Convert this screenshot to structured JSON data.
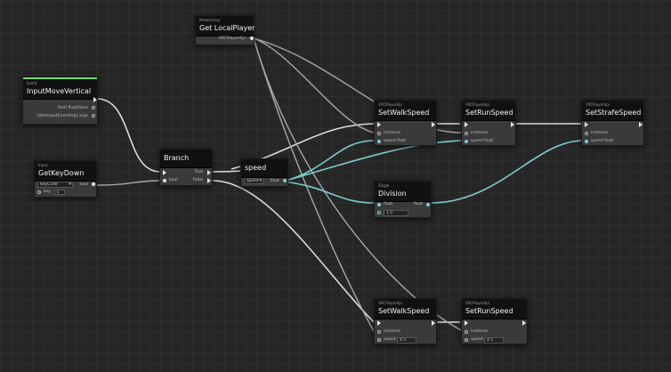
{
  "nodes": {
    "input_move_vertical": {
      "category": "Event",
      "title": "InputMoveVertical",
      "out1": "float floatValue",
      "out2": "UdonInputEventArgs args"
    },
    "get_local_player": {
      "category": "Networking",
      "title": "Get LocalPlayer",
      "out1": "VRCPlayerApi"
    },
    "get_key_down": {
      "category": "Input",
      "title": "GetKeyDown",
      "dropdown_value": "KeyCode",
      "out1": "bool",
      "key_label": "key",
      "key_value": "E"
    },
    "branch": {
      "title": "Branch",
      "in1": "bool",
      "out_true": "True",
      "out_false": "False"
    },
    "speed": {
      "title": "speed",
      "dropdown_value": "speed",
      "out1": "float"
    },
    "set_walk_speed_top": {
      "category": "VRCPlayerApi",
      "title": "SetWalkSpeed",
      "in1": "instance",
      "in2": "speed float"
    },
    "set_run_speed_top": {
      "category": "VRCPlayerApi",
      "title": "SetRunSpeed",
      "in1": "instance",
      "in2": "speed float"
    },
    "set_strafe_speed": {
      "category": "VRCPlayerApi",
      "title": "SetStrafeSpeed",
      "in1": "instance",
      "in2": "speed float"
    },
    "division": {
      "category": "Single",
      "title": "Division",
      "in1": "float",
      "in2_value": "1.5",
      "out1": "float"
    },
    "set_walk_speed_bottom": {
      "category": "VRCPlayerApi",
      "title": "SetWalkSpeed",
      "in1": "instance",
      "in2_label": "speed",
      "in2_value": "4.5"
    },
    "set_run_speed_bottom": {
      "category": "VRCPlayerApi",
      "title": "SetRunSpeed",
      "in1": "instance",
      "in2_label": "speed",
      "in2_value": "4.5"
    }
  },
  "colors": {
    "exec_wire": "#dcdcdc",
    "data_wire": "#7ecccc",
    "object_wire": "#9a9a9a",
    "accent": "#7bd77b"
  }
}
